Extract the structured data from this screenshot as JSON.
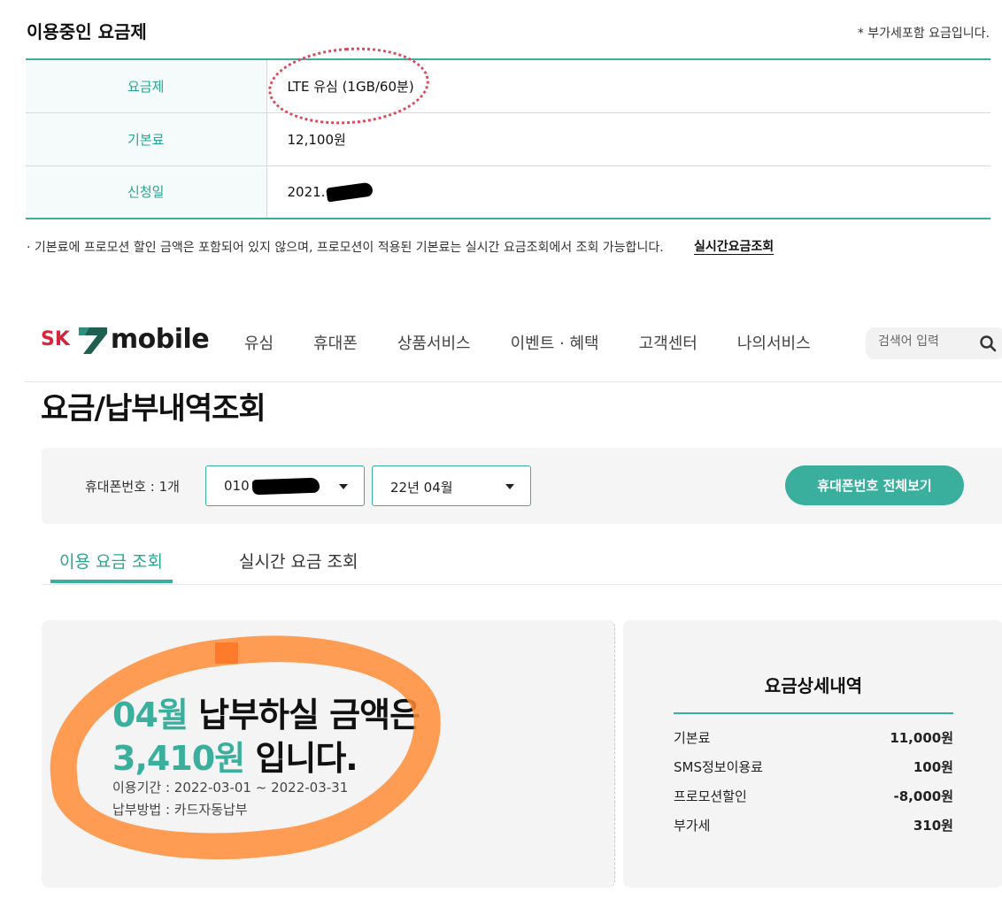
{
  "plan_section": {
    "title": "이용중인 요금제",
    "vat_note": "* 부가세포함 요금입니다.",
    "rows": [
      {
        "label": "요금제",
        "value": "LTE 유심 (1GB/60분)"
      },
      {
        "label": "기본료",
        "value": "12,100원"
      },
      {
        "label": "신청일",
        "value": "2021."
      }
    ],
    "footnote": "· 기본료에 프로모션 할인 금액은 포함되어 있지 않으며, 프로모션이 적용된 기본료는 실시간 요금조회에서 조회 가능합니다.",
    "footnote_link": "실시간요금조회"
  },
  "header": {
    "logo_sk": "SK",
    "logo_mobile": "mobile",
    "nav": [
      "유심",
      "휴대폰",
      "상품서비스",
      "이벤트 · 혜택",
      "고객센터",
      "나의서비스"
    ],
    "search_placeholder": "검색어 입력",
    "search_icon": "search-icon"
  },
  "page_title": "요금/납부내역조회",
  "filter": {
    "phone_count_label": "휴대폰번호 : 1개",
    "phone_select_value": "010",
    "month_select_value": "22년 04월",
    "view_all_button": "휴대폰번호 전체보기"
  },
  "tabs": [
    {
      "label": "이용 요금 조회",
      "active": true
    },
    {
      "label": "실시간 요금 조회",
      "active": false
    }
  ],
  "summary": {
    "month": "04월",
    "line1_rest": "납부하실 금액은",
    "amount": "3,410원",
    "line2_rest": "입니다.",
    "period": "이용기간 : 2022-03-01 ~ 2022-03-31",
    "payment_method": "납부방법 : 카드자동납부"
  },
  "detail": {
    "title": "요금상세내역",
    "rows": [
      {
        "label": "기본료",
        "amount": "11,000원"
      },
      {
        "label": "SMS정보이용료",
        "amount": "100원"
      },
      {
        "label": "프로모션할인",
        "amount": "-8,000원"
      },
      {
        "label": "부가세",
        "amount": "310원"
      }
    ]
  },
  "colors": {
    "accent": "#3aaf9d",
    "accent_text": "#26a68f",
    "brand_red": "#d6263c",
    "annotation_orange": "#ff8c37",
    "annotation_red": "#e0475b"
  }
}
